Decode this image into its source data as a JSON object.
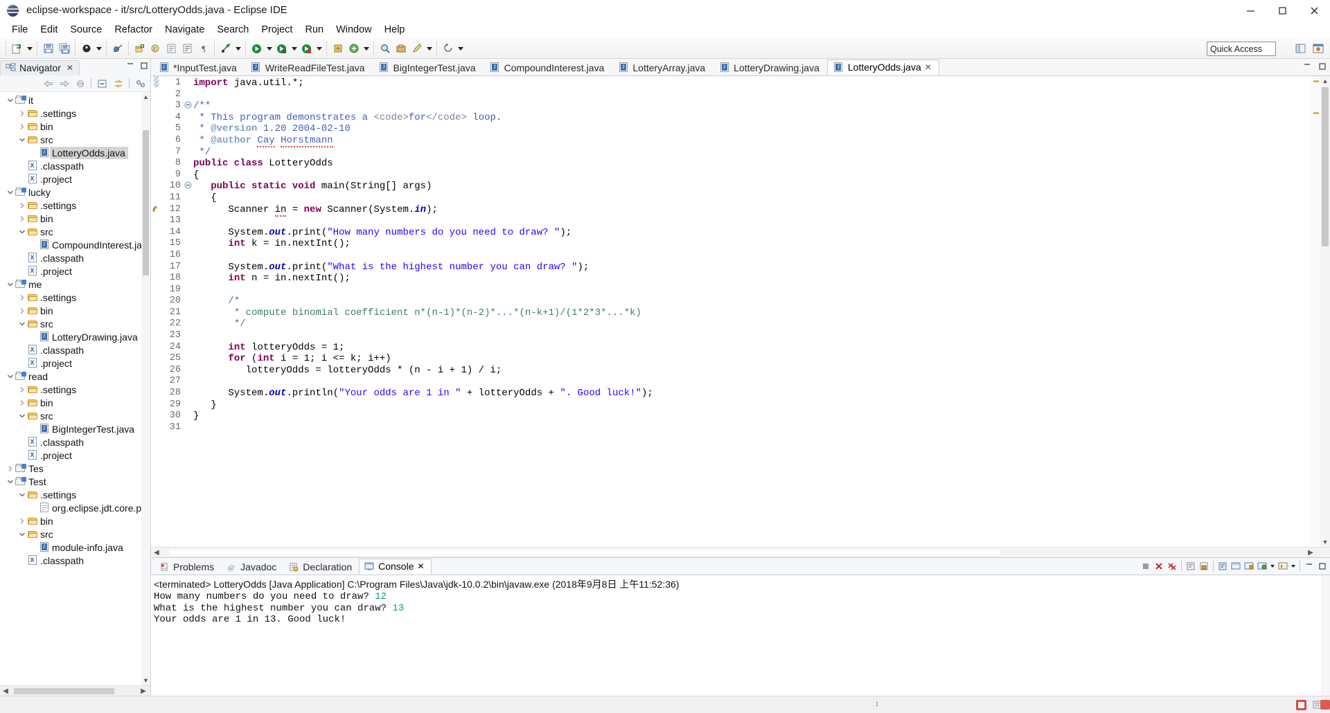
{
  "window": {
    "title": "eclipse-workspace - it/src/LotteryOdds.java - Eclipse IDE",
    "app_icon": "eclipse-globe-icon",
    "minimize": "minimize-icon",
    "maximize": "maximize-icon",
    "close": "close-icon"
  },
  "menubar": {
    "items": [
      "File",
      "Edit",
      "Source",
      "Refactor",
      "Navigate",
      "Search",
      "Project",
      "Run",
      "Window",
      "Help"
    ]
  },
  "toolbar": {
    "quick_access": "Quick Access",
    "buttons": [
      "new-wizard-icon",
      "new-dropdown-arrow",
      "save-icon",
      "save-all-icon",
      "debug-icon",
      "debug-dropdown-arrow",
      "skip-breakpoints-icon",
      "new-java-package-icon",
      "new-java-class-icon",
      "new-java-interface-icon",
      "open-type-icon",
      "pilcrow-icon",
      "external-tools-icon",
      "external-tools-arrow",
      "run-icon",
      "run-arrow",
      "debug-run-icon",
      "debug-run-arrow",
      "coverage-icon",
      "coverage-arrow",
      "new-annotation-icon",
      "next-annotation-icon",
      "annotation-arrow",
      "search-icon",
      "open-task-icon",
      "pencil-icon",
      "pencil-arrow",
      "previous-edit-icon",
      "previous-edit-arrow"
    ],
    "perspective_buttons": [
      "open-perspective-icon",
      "java-perspective-icon"
    ]
  },
  "navigator": {
    "tab_label": "Navigator",
    "tab_close": "close-icon",
    "minimize": "minimize-icon",
    "maximize": "maximize-icon",
    "toolbar_buttons": [
      "back-arrow-icon",
      "forward-arrow-icon",
      "home-icon",
      "collapse-all-icon",
      "link-with-editor-icon",
      "view-menu-icon"
    ],
    "tree": [
      {
        "label": "it",
        "depth": 0,
        "icon": "project-icon",
        "twisty": "expanded",
        "selected": false
      },
      {
        "label": ".settings",
        "depth": 1,
        "icon": "folder-icon",
        "twisty": "collapsed",
        "selected": false
      },
      {
        "label": "bin",
        "depth": 1,
        "icon": "folder-icon",
        "twisty": "collapsed",
        "selected": false
      },
      {
        "label": "src",
        "depth": 1,
        "icon": "folder-icon",
        "twisty": "expanded",
        "selected": false
      },
      {
        "label": "LotteryOdds.java",
        "depth": 2,
        "icon": "java-file-icon",
        "twisty": "none",
        "selected": true
      },
      {
        "label": ".classpath",
        "depth": 1,
        "icon": "x-file-icon",
        "twisty": "none",
        "selected": false
      },
      {
        "label": ".project",
        "depth": 1,
        "icon": "x-file-icon",
        "twisty": "none",
        "selected": false
      },
      {
        "label": "lucky",
        "depth": 0,
        "icon": "project-icon",
        "twisty": "expanded",
        "selected": false
      },
      {
        "label": ".settings",
        "depth": 1,
        "icon": "folder-icon",
        "twisty": "collapsed",
        "selected": false
      },
      {
        "label": "bin",
        "depth": 1,
        "icon": "folder-icon",
        "twisty": "collapsed",
        "selected": false
      },
      {
        "label": "src",
        "depth": 1,
        "icon": "folder-icon",
        "twisty": "expanded",
        "selected": false
      },
      {
        "label": "CompoundInterest.ja",
        "depth": 2,
        "icon": "java-file-icon",
        "twisty": "none",
        "selected": false
      },
      {
        "label": ".classpath",
        "depth": 1,
        "icon": "x-file-icon",
        "twisty": "none",
        "selected": false
      },
      {
        "label": ".project",
        "depth": 1,
        "icon": "x-file-icon",
        "twisty": "none",
        "selected": false
      },
      {
        "label": "me",
        "depth": 0,
        "icon": "project-icon",
        "twisty": "expanded",
        "selected": false
      },
      {
        "label": ".settings",
        "depth": 1,
        "icon": "folder-icon",
        "twisty": "collapsed",
        "selected": false
      },
      {
        "label": "bin",
        "depth": 1,
        "icon": "folder-icon",
        "twisty": "collapsed",
        "selected": false
      },
      {
        "label": "src",
        "depth": 1,
        "icon": "folder-icon",
        "twisty": "expanded",
        "selected": false
      },
      {
        "label": "LotteryDrawing.java",
        "depth": 2,
        "icon": "java-file-icon",
        "twisty": "none",
        "selected": false
      },
      {
        "label": ".classpath",
        "depth": 1,
        "icon": "x-file-icon",
        "twisty": "none",
        "selected": false
      },
      {
        "label": ".project",
        "depth": 1,
        "icon": "x-file-icon",
        "twisty": "none",
        "selected": false
      },
      {
        "label": "read",
        "depth": 0,
        "icon": "project-icon",
        "twisty": "expanded",
        "selected": false
      },
      {
        "label": ".settings",
        "depth": 1,
        "icon": "folder-icon",
        "twisty": "collapsed",
        "selected": false
      },
      {
        "label": "bin",
        "depth": 1,
        "icon": "folder-icon",
        "twisty": "collapsed",
        "selected": false
      },
      {
        "label": "src",
        "depth": 1,
        "icon": "folder-icon",
        "twisty": "expanded",
        "selected": false
      },
      {
        "label": "BigIntegerTest.java",
        "depth": 2,
        "icon": "java-file-icon",
        "twisty": "none",
        "selected": false
      },
      {
        "label": ".classpath",
        "depth": 1,
        "icon": "x-file-icon",
        "twisty": "none",
        "selected": false
      },
      {
        "label": ".project",
        "depth": 1,
        "icon": "x-file-icon",
        "twisty": "none",
        "selected": false
      },
      {
        "label": "Tes",
        "depth": 0,
        "icon": "project-icon",
        "twisty": "collapsed",
        "selected": false
      },
      {
        "label": "Test",
        "depth": 0,
        "icon": "project-icon",
        "twisty": "expanded",
        "selected": false
      },
      {
        "label": ".settings",
        "depth": 1,
        "icon": "folder-icon",
        "twisty": "expanded",
        "selected": false
      },
      {
        "label": "org.eclipse.jdt.core.p",
        "depth": 2,
        "icon": "doc-file-icon",
        "twisty": "none",
        "selected": false
      },
      {
        "label": "bin",
        "depth": 1,
        "icon": "folder-icon",
        "twisty": "collapsed",
        "selected": false
      },
      {
        "label": "src",
        "depth": 1,
        "icon": "folder-icon",
        "twisty": "expanded",
        "selected": false
      },
      {
        "label": "module-info.java",
        "depth": 2,
        "icon": "java-file-icon",
        "twisty": "none",
        "selected": false
      },
      {
        "label": ".classpath",
        "depth": 1,
        "icon": "x-file-icon",
        "twisty": "none",
        "selected": false
      }
    ]
  },
  "editor": {
    "tabs": [
      {
        "label": "*InputTest.java",
        "active": false,
        "dirty": true
      },
      {
        "label": "WriteReadFileTest.java",
        "active": false,
        "dirty": false
      },
      {
        "label": "BigIntegerTest.java",
        "active": false,
        "dirty": false
      },
      {
        "label": "CompoundInterest.java",
        "active": false,
        "dirty": false
      },
      {
        "label": "LotteryArray.java",
        "active": false,
        "dirty": false
      },
      {
        "label": "LotteryDrawing.java",
        "active": false,
        "dirty": false
      },
      {
        "label": "LotteryOdds.java",
        "active": true,
        "dirty": false
      }
    ],
    "tab_close": "close-icon",
    "minimize": "minimize-icon",
    "maximize": "maximize-icon",
    "file_name": "LotteryOdds.java",
    "lines": [
      {
        "n": 1,
        "fold": false,
        "marker": "changed",
        "html": "<span class=\"kw\">import</span> java.util.*;"
      },
      {
        "n": 2,
        "fold": false,
        "marker": "",
        "html": ""
      },
      {
        "n": 3,
        "fold": true,
        "marker": "",
        "html": "<span class=\"jdoc\">/**</span>"
      },
      {
        "n": 4,
        "fold": false,
        "marker": "",
        "html": "<span class=\"jdoc\"> * This program demonstrates a </span><span class=\"jdoc-html\">&lt;code&gt;</span><span class=\"jdoc\">for</span><span class=\"jdoc-html\">&lt;/code&gt;</span><span class=\"jdoc\"> loop.</span>"
      },
      {
        "n": 5,
        "fold": false,
        "marker": "",
        "html": "<span class=\"jdoc\"> * </span><span class=\"jdoc-tag\">@version</span><span class=\"jdoc\"> 1.20 2004-02-10</span>"
      },
      {
        "n": 6,
        "fold": false,
        "marker": "",
        "html": "<span class=\"jdoc\"> * </span><span class=\"jdoc-tag\">@author</span><span class=\"jdoc\"> </span><span class=\"jdoc spell\">Cay</span><span class=\"jdoc\"> </span><span class=\"jdoc spell\">Horstmann</span>"
      },
      {
        "n": 7,
        "fold": false,
        "marker": "",
        "html": "<span class=\"jdoc\"> */</span>"
      },
      {
        "n": 8,
        "fold": false,
        "marker": "",
        "html": "<span class=\"kw\">public class</span> LotteryOdds"
      },
      {
        "n": 9,
        "fold": false,
        "marker": "",
        "html": "{"
      },
      {
        "n": 10,
        "fold": true,
        "marker": "",
        "html": "   <span class=\"kw\">public static void</span> main(String[] args)"
      },
      {
        "n": 11,
        "fold": false,
        "marker": "",
        "html": "   {"
      },
      {
        "n": 12,
        "fold": false,
        "marker": "warning",
        "html": "      Scanner <span class=\"spell\">in</span> = <span class=\"kw\">new</span> Scanner(System.<span class=\"stat\">in</span>);"
      },
      {
        "n": 13,
        "fold": false,
        "marker": "",
        "html": ""
      },
      {
        "n": 14,
        "fold": false,
        "marker": "",
        "html": "      System.<span class=\"stat\">out</span>.print(<span class=\"str\">\"How many numbers do you need to draw? \"</span>);"
      },
      {
        "n": 15,
        "fold": false,
        "marker": "",
        "html": "      <span class=\"kw\">int</span> k = in.nextInt();"
      },
      {
        "n": 16,
        "fold": false,
        "marker": "",
        "html": ""
      },
      {
        "n": 17,
        "fold": false,
        "marker": "",
        "html": "      System.<span class=\"stat\">out</span>.print(<span class=\"str\">\"What is the highest number you can draw? \"</span>);"
      },
      {
        "n": 18,
        "fold": false,
        "marker": "",
        "html": "      <span class=\"kw\">int</span> n = in.nextInt();"
      },
      {
        "n": 19,
        "fold": false,
        "marker": "",
        "html": ""
      },
      {
        "n": 20,
        "fold": false,
        "marker": "",
        "html": "      <span class=\"cmt\">/*</span>"
      },
      {
        "n": 21,
        "fold": false,
        "marker": "",
        "html": "      <span class=\"cmt\"> * compute binomial coefficient n*(n-1)*(n-2)*...*(n-k+1)/(1*2*3*...*k)</span>"
      },
      {
        "n": 22,
        "fold": false,
        "marker": "",
        "html": "      <span class=\"cmt\"> */</span>"
      },
      {
        "n": 23,
        "fold": false,
        "marker": "",
        "html": ""
      },
      {
        "n": 24,
        "fold": false,
        "marker": "",
        "html": "      <span class=\"kw\">int</span> lotteryOdds = 1;"
      },
      {
        "n": 25,
        "fold": false,
        "marker": "",
        "html": "      <span class=\"kw\">for</span> (<span class=\"kw\">int</span> i = 1; i &lt;= k; i++)"
      },
      {
        "n": 26,
        "fold": false,
        "marker": "",
        "html": "         lotteryOdds = lotteryOdds * (n - i + 1) / i;"
      },
      {
        "n": 27,
        "fold": false,
        "marker": "",
        "html": ""
      },
      {
        "n": 28,
        "fold": false,
        "marker": "",
        "html": "      System.<span class=\"stat\">out</span>.println(<span class=\"str\">\"Your odds are 1 in \"</span> + lotteryOdds + <span class=\"str\">\". Good luck!\"</span>);"
      },
      {
        "n": 29,
        "fold": false,
        "marker": "",
        "html": "   }"
      },
      {
        "n": 30,
        "fold": false,
        "marker": "",
        "html": "}"
      },
      {
        "n": 31,
        "fold": false,
        "marker": "",
        "html": ""
      }
    ]
  },
  "console_panel": {
    "tabs": [
      {
        "label": "Problems",
        "icon": "problems-icon",
        "active": false
      },
      {
        "label": "Javadoc",
        "icon": "javadoc-icon",
        "active": false
      },
      {
        "label": "Declaration",
        "icon": "declaration-icon",
        "active": false
      },
      {
        "label": "Console",
        "icon": "console-icon",
        "active": true
      }
    ],
    "tab_close": "close-icon",
    "toolbar_buttons": [
      "terminate-icon",
      "remove-launch-icon",
      "remove-all-launches-icon",
      "clear-console-icon",
      "scroll-lock-icon",
      "word-wrap-icon",
      "show-console-icon",
      "pin-console-icon",
      "display-selected-console-icon",
      "display-console-arrow",
      "open-console-icon",
      "open-console-arrow",
      "minimize-icon",
      "maximize-icon"
    ],
    "header": "<terminated> LotteryOdds [Java Application] C:\\Program Files\\Java\\jdk-10.0.2\\bin\\javaw.exe (2018年9月8日 上午11:52:36)",
    "output": [
      {
        "prompt": "How many numbers do you need to draw? ",
        "input": "12"
      },
      {
        "prompt": "What is the highest number you can draw? ",
        "input": "13"
      },
      {
        "prompt": "Your odds are 1 in 13. Good luck!",
        "input": ""
      }
    ]
  },
  "statusbar": {
    "left_text": "",
    "tray": [
      "status-error-badge",
      "tray-icon"
    ]
  },
  "colors": {
    "keyword": "#7f0055",
    "string": "#2a00ff",
    "comment": "#3f7f5f",
    "javadoc": "#3f5fbf",
    "javadoc_tag": "#7f9fbf",
    "console_input": "#00a08a",
    "selection": "#d4d4d4",
    "accent": "#4a80c6"
  }
}
